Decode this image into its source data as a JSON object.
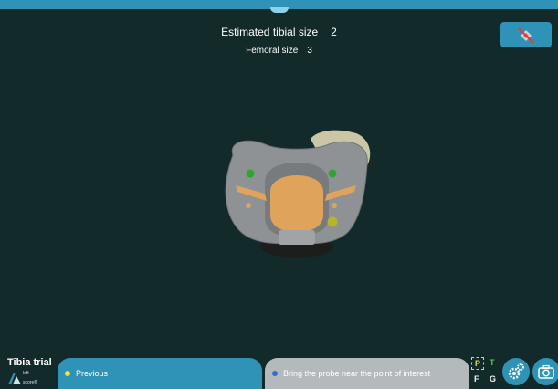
{
  "header": {
    "tibial_label": "Estimated tibial size",
    "tibial_value": "2",
    "femoral_label": "Femoral size",
    "femoral_value": "3"
  },
  "icons": {
    "tool": "crossed-tool-icon",
    "settings": "gear-icon",
    "camera": "camera-icon",
    "logo": "score-logo-icon"
  },
  "footer": {
    "app_title": "Tibia trial",
    "side": "left",
    "brand": "score®",
    "previous_label": "Previous",
    "status_message": "Bring the probe near the point of interest",
    "indicators": {
      "p": "P",
      "t": "T",
      "f": "F",
      "g": "G"
    }
  },
  "colors": {
    "background": "#132a2a",
    "accent": "#2f93b8",
    "status_bar": "#b4b9bb",
    "implant": "#8e9295",
    "bone": "#e0a35b",
    "marker_green": "#2aa82a",
    "marker_yellow": "#b7b32a"
  }
}
